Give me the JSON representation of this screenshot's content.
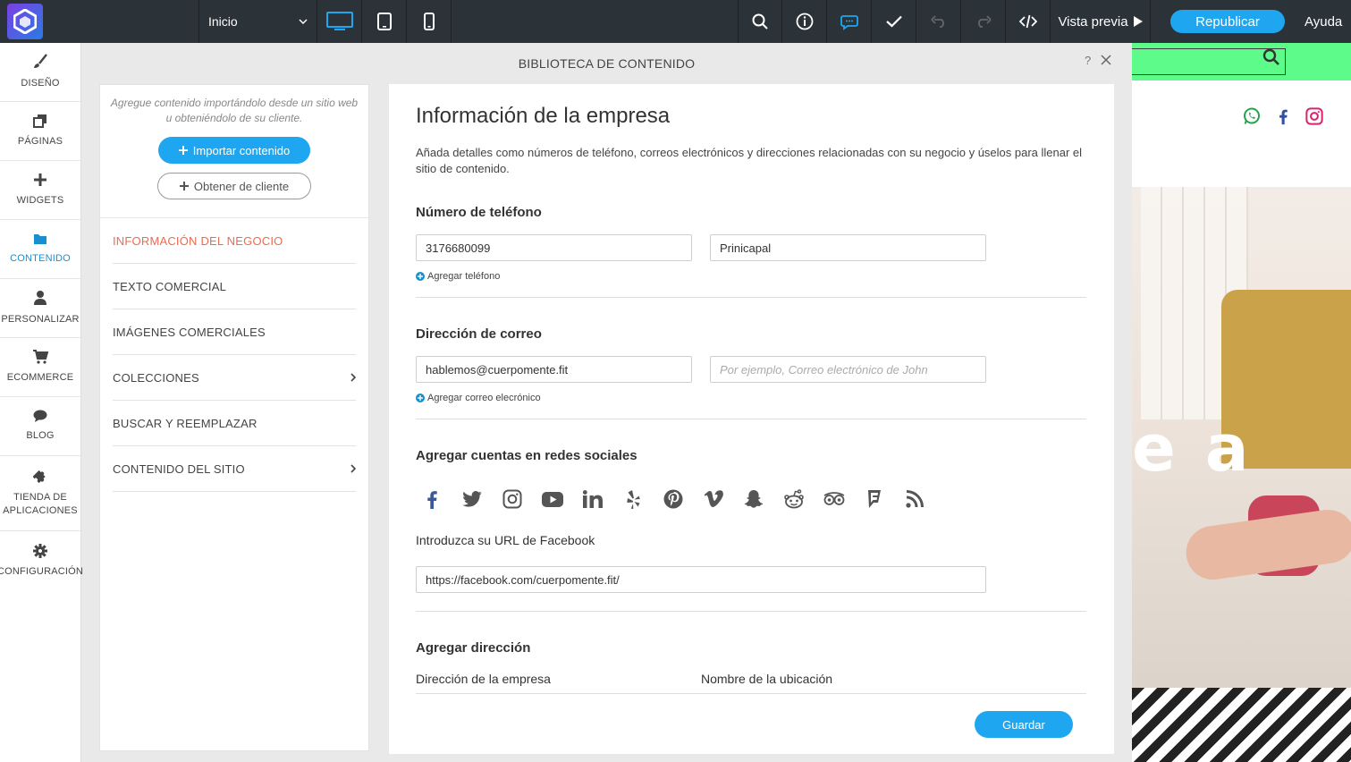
{
  "topbar": {
    "page_select": "Inicio",
    "preview": "Vista previa",
    "republish": "Republicar",
    "help": "Ayuda"
  },
  "leftnav": [
    {
      "label": "DISEÑO",
      "icon": "brush-icon"
    },
    {
      "label": "PÁGINAS",
      "icon": "pages-icon"
    },
    {
      "label": "WIDGETS",
      "icon": "plus-icon"
    },
    {
      "label": "CONTENIDO",
      "icon": "folder-icon",
      "active": true
    },
    {
      "label": "PERSONALIZAR",
      "icon": "user-icon"
    },
    {
      "label": "ECOMMERCE",
      "icon": "cart-icon"
    },
    {
      "label": "BLOG",
      "icon": "chat-bubble-icon"
    },
    {
      "label": "TIENDA DE APLICACIONES",
      "icon": "puzzle-icon"
    },
    {
      "label": "CONFIGURACIÓN",
      "icon": "gear-icon"
    }
  ],
  "library": {
    "title": "BIBLIOTECA DE CONTENIDO",
    "help": "?"
  },
  "leftpanel": {
    "hint": "Agregue contenido importándolo desde un sitio web u obteniéndolo de su cliente.",
    "import_button": "Importar contenido",
    "client_button": "Obtener de cliente",
    "menu": [
      {
        "label": "INFORMACIÓN DEL NEGOCIO",
        "active": true,
        "chevron": false
      },
      {
        "label": "TEXTO COMERCIAL",
        "chevron": false
      },
      {
        "label": "IMÁGENES COMERCIALES",
        "chevron": false
      },
      {
        "label": "COLECCIONES",
        "chevron": true
      },
      {
        "label": "BUSCAR Y REEMPLAZAR",
        "chevron": false
      },
      {
        "label": "CONTENIDO DEL SITIO",
        "chevron": true
      }
    ]
  },
  "main": {
    "title": "Información de la empresa",
    "description": "Añada detalles como números de teléfono, correos electrónicos y direcciones relacionadas con su negocio y úselos para llenar el sitio de contenido.",
    "phone": {
      "heading": "Número de teléfono",
      "value": "3176680099",
      "label_value": "Prinicapal",
      "add_link": "Agregar teléfono"
    },
    "email": {
      "heading": "Dirección de correo",
      "value": "hablemos@cuerpomente.fit",
      "label_placeholder": "Por ejemplo, Correo electrónico de John",
      "add_link": "Agregar correo elecrónico"
    },
    "social": {
      "heading": "Agregar cuentas en redes sociales",
      "icons": [
        "facebook-icon",
        "twitter-icon",
        "instagram-icon",
        "youtube-icon",
        "linkedin-icon",
        "yelp-icon",
        "pinterest-icon",
        "vimeo-icon",
        "snapchat-icon",
        "reddit-icon",
        "tripadvisor-icon",
        "foursquare-icon",
        "rss-icon"
      ],
      "url_label": "Introduzca su URL de Facebook",
      "url_value": "https://facebook.com/cuerpomente.fit/"
    },
    "address": {
      "heading": "Agregar dirección",
      "col1": "Dirección de la empresa",
      "col2": "Nombre de la ubicación"
    },
    "save": "Guardar"
  },
  "site_preview": {
    "hero_text": "e a",
    "social_icons": [
      "whatsapp-icon",
      "facebook-icon",
      "instagram-icon"
    ],
    "colors": {
      "topbar": "#5dfc8a"
    }
  },
  "colors": {
    "accent": "#1ea7f0",
    "active_menu": "#ef6a4f",
    "topbar": "#2b3238"
  }
}
